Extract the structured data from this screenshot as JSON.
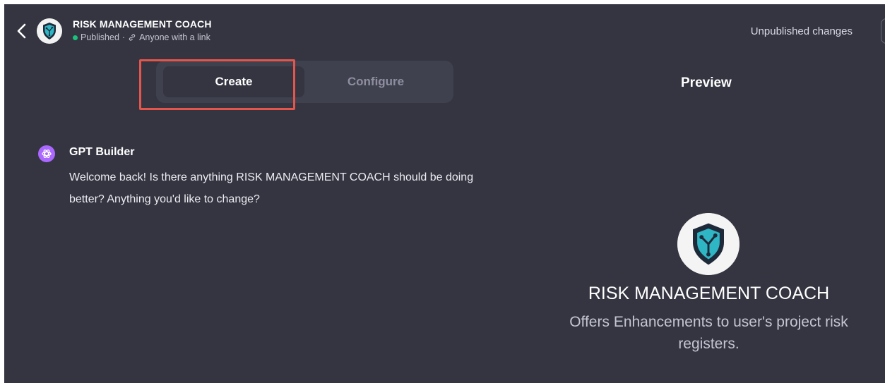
{
  "header": {
    "title": "RISK MANAGEMENT COACH",
    "status": "Published",
    "separator": "·",
    "visibility": "Anyone with a link",
    "unpublished_changes": "Unpublished changes"
  },
  "tabs": [
    {
      "label": "Create",
      "active": true
    },
    {
      "label": "Configure",
      "active": false
    }
  ],
  "preview": {
    "label": "Preview",
    "gpt_name": "RISK MANAGEMENT COACH",
    "description": "Offers Enhancements to user's project risk registers."
  },
  "chat": {
    "sender": "GPT Builder",
    "message": "Welcome back! Is there anything RISK MANAGEMENT COACH should be doing better? Anything you'd like to change?"
  },
  "icons": {
    "back": "chevron-left-icon",
    "link": "link-icon",
    "gpt_avatar": "shield-circuit-icon",
    "builder_avatar": "openai-logo-icon"
  },
  "colors": {
    "background": "#343541",
    "tabs_background": "#40414f",
    "status_dot": "#19c37d",
    "highlight": "#e4554b",
    "builder_avatar": "#ab68ff"
  }
}
